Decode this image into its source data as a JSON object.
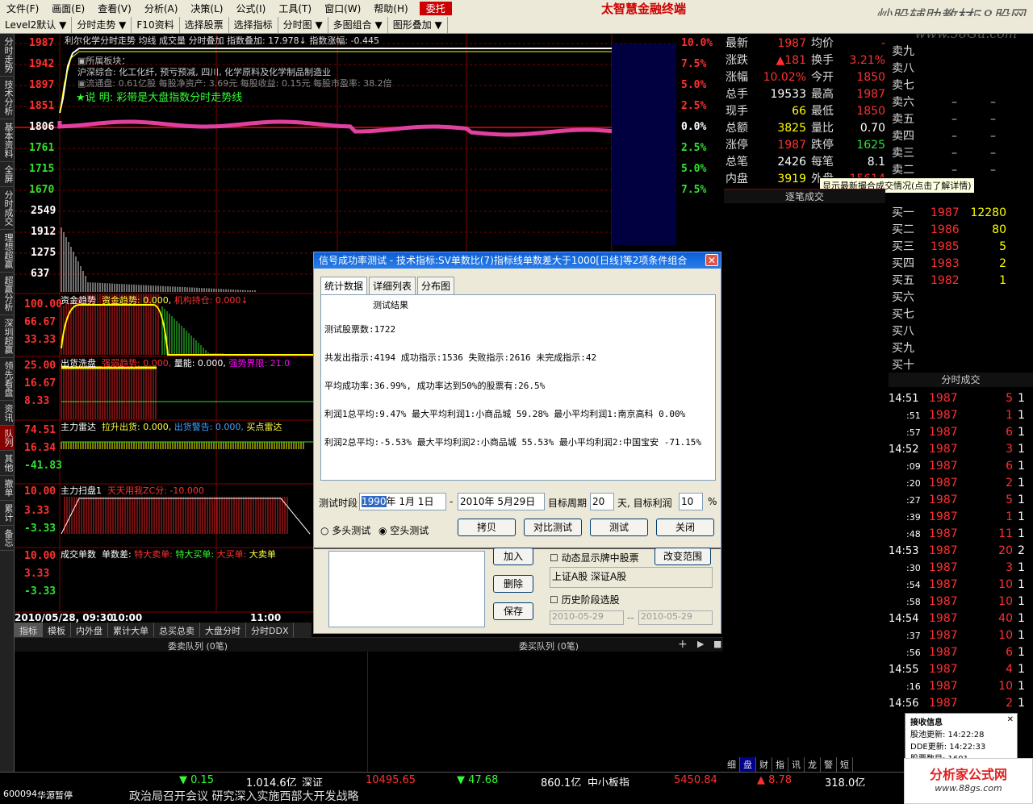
{
  "menu": [
    "文件(F)",
    "画面(E)",
    "查看(V)",
    "分析(A)",
    "决策(L)",
    "公式(I)",
    "工具(T)",
    "窗口(W)",
    "帮助(H)",
    "委托"
  ],
  "brand": "太智慧金融终端",
  "watermark": {
    "line1": "炒股辅助教材58股网",
    "line2": "www.58Gu.com"
  },
  "toolbar": [
    "Level2默认",
    "分时走势",
    "F10资料",
    "选择股票",
    "选择指标",
    "分时图",
    "多图组合",
    "图形叠加"
  ],
  "left_tabs": [
    "分时走势",
    "技术分析",
    "基本资料",
    "全屏",
    "分时成交",
    "理想超赢",
    "超赢分析",
    "深圳超赢",
    "领先看盘",
    "资讯",
    "队列",
    "其他",
    "撤单",
    "累计",
    "备忘"
  ],
  "chart": {
    "header": "利尔化学分时走势  均线  成交量  分时叠加  指数叠加: 17.978↓    指数涨幅: -0.445",
    "sector_title": "▣所属板块：",
    "sector_line": "沪深综合: 化工化纤, 预亏预减, 四川, 化学原料及化学制品制造业",
    "fin_line": "▣流通盘: 0.61亿股    每股净资产: 3.69元    每股收益: 0.15元    每股市盈率: 38.2倍",
    "note": "★说 明:   彩带是大盘指数分时走势线",
    "price_labels": [
      "1987",
      "1942",
      "1897",
      "1851",
      "1806",
      "1761",
      "1715",
      "1670"
    ],
    "pct_labels": [
      "10.0%",
      "7.5%",
      "5.0%",
      "2.5%",
      "0.0%",
      "2.5%",
      "5.0%",
      "7.5%"
    ],
    "vol_labels": [
      "2549",
      "1912",
      "1275",
      "637"
    ],
    "ind1": {
      "title": "资金趋势",
      "sub": "资金趋势: 0.000,",
      "sub2": "机构持仓: 0.000↓",
      "y": [
        "100.00",
        "66.67",
        "33.33"
      ]
    },
    "ind2": {
      "title": "出货洗盘",
      "sub": "强弱趋势: 0.000,",
      "sub2": "量能: 0.000,",
      "sub3": "强势界限: 21.0",
      "y": [
        "25.00",
        "16.67",
        "8.33"
      ]
    },
    "ind3": {
      "title": "主力雷达",
      "sub": "拉升出货: 0.000,",
      "sub2": "出货警告: 0.000,",
      "sub3": "买点雷达",
      "y": [
        "74.51",
        "16.34",
        "-41.83"
      ]
    },
    "ind4": {
      "title": "主力扫盘1",
      "sub": "天天用我ZC分: -10.000",
      "y": [
        "10.00",
        "3.33",
        "-3.33"
      ]
    },
    "ind5": {
      "title": "成交单数",
      "sub": "单数差:",
      "sub2": "特大卖单:",
      "sub3": "特大买单:",
      "sub4": "大买单:",
      "sub5": "大卖单",
      "y": [
        "10.00",
        "3.33",
        "-3.33"
      ]
    },
    "time_labels": [
      "2010/05/28, 09:30",
      "10:00",
      "11:00"
    ],
    "bottom_tabs": [
      "指标",
      "模板",
      "内外盘",
      "累计大单",
      "总买总卖",
      "大盘分时",
      "分时DDX"
    ],
    "queue_left": "委卖队列 (0笔)",
    "queue_right": "委买队列 (0笔)"
  },
  "quote": {
    "rows": [
      [
        "最新",
        "1987",
        "均价",
        "-"
      ],
      [
        "涨跌",
        "▲181",
        "换手",
        "3.21%"
      ],
      [
        "涨幅",
        "10.02%",
        "今开",
        "1850"
      ],
      [
        "总手",
        "19533",
        "最高",
        "1987"
      ],
      [
        "现手",
        "66",
        "最低",
        "1850"
      ],
      [
        "总额",
        "3825",
        "量比",
        "0.70"
      ],
      [
        "涨停",
        "1987",
        "跌停",
        "1625"
      ],
      [
        "总笔",
        "2426",
        "每笔",
        "8.1"
      ],
      [
        "内盘",
        "3919",
        "外盘",
        "15614"
      ]
    ],
    "sells": [
      "卖九",
      "卖八",
      "卖七",
      "卖六",
      "卖五",
      "卖四",
      "卖三",
      "卖二"
    ],
    "tooltip": "显示最新撮合成交情况(点击了解详情)",
    "tick_title": "逐笔成交",
    "buys": [
      [
        "买一",
        "1987",
        "12280"
      ],
      [
        "买二",
        "1986",
        "80"
      ],
      [
        "买三",
        "1985",
        "5"
      ],
      [
        "买四",
        "1983",
        "2"
      ],
      [
        "买五",
        "1982",
        "1"
      ],
      [
        "买六",
        "",
        ""
      ],
      [
        "买七",
        "",
        ""
      ],
      [
        "买八",
        "",
        ""
      ],
      [
        "买九",
        "",
        ""
      ],
      [
        "买十",
        "",
        ""
      ]
    ],
    "minute_title": "分时成交",
    "ticks": [
      [
        "14:51",
        "1987",
        "5",
        "1"
      ],
      [
        ":51",
        "1987",
        "1",
        "1"
      ],
      [
        ":57",
        "1987",
        "6",
        "1"
      ],
      [
        "14:52",
        "1987",
        "3",
        "1"
      ],
      [
        ":09",
        "1987",
        "6",
        "1"
      ],
      [
        ":20",
        "1987",
        "2",
        "1"
      ],
      [
        ":27",
        "1987",
        "5",
        "1"
      ],
      [
        ":39",
        "1987",
        "1",
        "1"
      ],
      [
        ":48",
        "1987",
        "11",
        "1"
      ],
      [
        "14:53",
        "1987",
        "20",
        "2"
      ],
      [
        ":30",
        "1987",
        "3",
        "1"
      ],
      [
        ":54",
        "1987",
        "10",
        "1"
      ],
      [
        ":58",
        "1987",
        "10",
        "1"
      ],
      [
        "14:54",
        "1987",
        "40",
        "1"
      ],
      [
        ":37",
        "1987",
        "10",
        "1"
      ],
      [
        ":56",
        "1987",
        "6",
        "1"
      ],
      [
        "14:55",
        "1987",
        "4",
        "1"
      ],
      [
        ":16",
        "1987",
        "10",
        "1"
      ],
      [
        "14:56",
        "1987",
        "2",
        "1"
      ]
    ],
    "bottom_tabs": [
      "细",
      "盘",
      "财",
      "指",
      "讯",
      "龙",
      "警",
      "短"
    ],
    "notify": {
      "title": "接收信息",
      "r1": "股池更新:  14:22:28",
      "r2": "DDE更新:   14:22:33",
      "r3": "股票数目:  1601"
    }
  },
  "dialog": {
    "title": "信号成功率测试 - 技术指标:SV单数比(7)指标线单数差大于1000[日线]等2项条件组合",
    "tabs": [
      "统计数据",
      "详细列表",
      "分布图"
    ],
    "result_title": "测试结果",
    "lines": [
      "测试股票数:1722",
      "共发出指示:4194 成功指示:1536 失败指示:2616 未完成指示:42",
      "平均成功率:36.99%, 成功率达到50%的股票有:26.5%",
      "利润1总平均:9.47% 最大平均利润1:小商品城 59.28% 最小平均利润1:南京高科 0.00%",
      "利润2总平均:-5.53% 最大平均利润2:小商品城 55.53% 最小平均利润2:中国宝安 -71.15%"
    ],
    "period_label": "测试时段",
    "date_from_year": "1990",
    "date_from_rest": "年  1月  1日",
    "date_to": "2010年  5月29日",
    "target_period_label": "目标周期",
    "target_period": "20",
    "target_profit_label": "天, 目标利润",
    "target_profit": "10",
    "pct": "%",
    "radio1": "多头测试",
    "radio2": "空头测试",
    "btns": [
      "拷贝",
      "对比测试",
      "测试",
      "关闭"
    ],
    "lower": {
      "add": "加入",
      "del": "删除",
      "save": "保存",
      "chk1": "动态显示牌中股票",
      "range_btn": "改变范围",
      "market": "上证A股 深证A股",
      "chk2": "历史阶段选股",
      "d1": "2010-05-29",
      "d2": "2010-05-29"
    }
  },
  "bottom": {
    "idx1": "▼ 0.15",
    "idx1v": "1,014.6亿",
    "name2": "深证",
    "v2": "10495.65",
    "c2": "▼ 47.68",
    "a2": "860.1亿",
    "name3": "中小板指",
    "v3": "5450.84",
    "c3": "▲ 8.78",
    "a3": "318.0亿",
    "code": "600094",
    "name": "华源暂停",
    "ticker": "政治局召开会议 研究深入实施西部大开发战略"
  },
  "logo2": "分析家公式网",
  "logo2url": "www.88gs.com"
}
